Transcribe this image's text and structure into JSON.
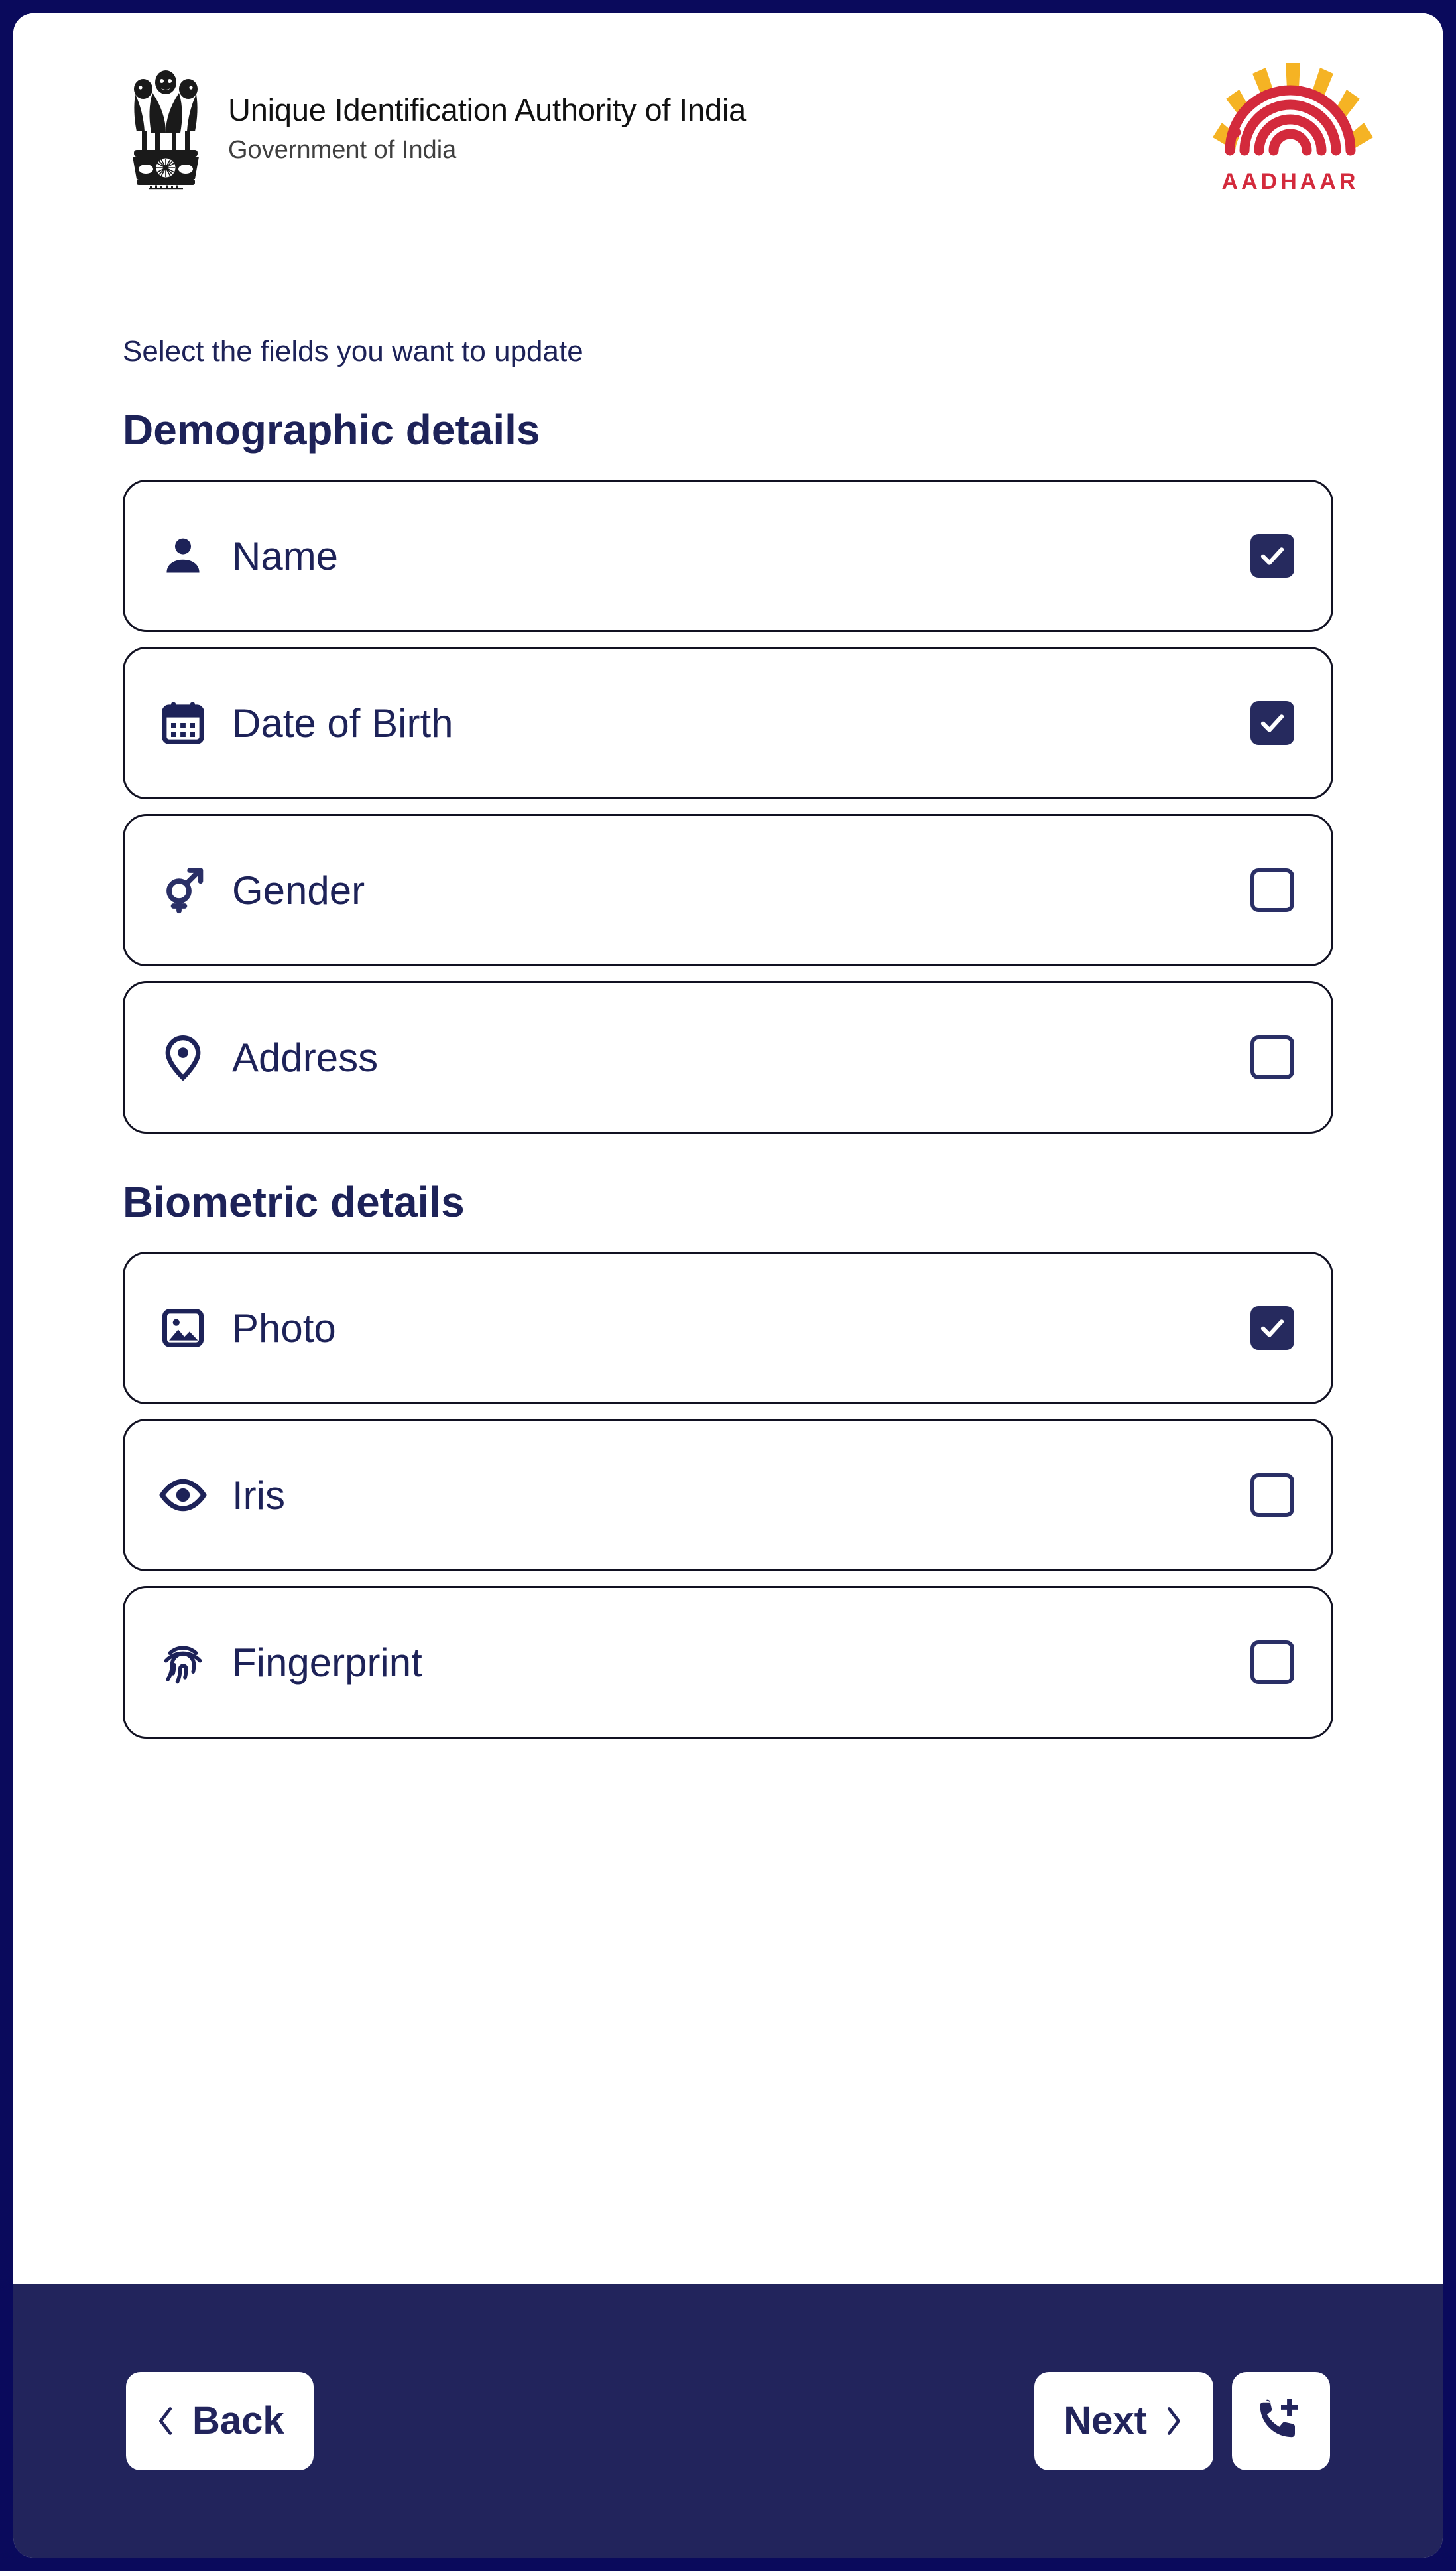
{
  "colors": {
    "frame_border": "#0a0a5c",
    "navy": "#1d2258",
    "bottom_bar": "#22245c",
    "checkbox_checked": "#262a5e",
    "aadhaar_red": "#d32a3c",
    "aadhaar_yellow": "#f5b324",
    "card_border": "#111122",
    "page_bg": "#ffffff"
  },
  "header": {
    "emblem_icon": "national-emblem-icon",
    "title": "Unique Identification Authority of India",
    "subtitle": "Government of India",
    "aadhaar_logo_icon": "aadhaar-fingerprint-sun-icon",
    "aadhaar_wordmark": "AADHAAR"
  },
  "main": {
    "instruction": "Select the fields you want to update",
    "sections": [
      {
        "id": "demographic",
        "title": "Demographic details",
        "fields": [
          {
            "id": "name",
            "label": "Name",
            "icon": "person-icon",
            "checked": true
          },
          {
            "id": "date-of-birth",
            "label": "Date of Birth",
            "icon": "calendar-icon",
            "checked": true
          },
          {
            "id": "gender",
            "label": "Gender",
            "icon": "gender-icon",
            "checked": false
          },
          {
            "id": "address",
            "label": "Address",
            "icon": "location-pin-icon",
            "checked": false
          }
        ]
      },
      {
        "id": "biometric",
        "title": "Biometric details",
        "fields": [
          {
            "id": "photo",
            "label": "Photo",
            "icon": "image-icon",
            "checked": true
          },
          {
            "id": "iris",
            "label": "Iris",
            "icon": "eye-icon",
            "checked": false
          },
          {
            "id": "fingerprint",
            "label": "Fingerprint",
            "icon": "fingerprint-icon",
            "checked": false
          }
        ]
      }
    ]
  },
  "bottom_bar": {
    "back_label": "Back",
    "back_icon": "chevron-left-icon",
    "next_label": "Next",
    "next_icon": "chevron-right-icon",
    "support_icon": "phone-add-icon"
  }
}
